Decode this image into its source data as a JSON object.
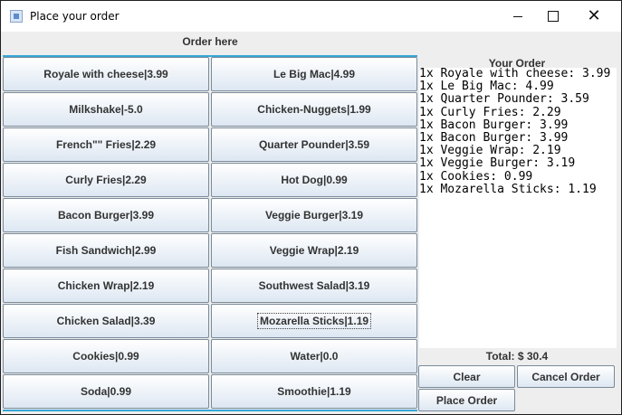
{
  "window": {
    "title": "Place your order",
    "controls": {
      "minimize": "minimize-icon",
      "maximize": "maximize-icon",
      "close": "close-icon"
    }
  },
  "menu": {
    "header": "Order here",
    "items": [
      "Royale with cheese|3.99",
      "Le Big Mac|4.99",
      "Milkshake|-5.0",
      "Chicken-Nuggets|1.99",
      "French\"\" Fries|2.29",
      "Quarter Pounder|3.59",
      "Curly Fries|2.29",
      "Hot Dog|0.99",
      "Bacon Burger|3.99",
      "Veggie Burger|3.19",
      "Fish Sandwich|2.99",
      "Veggie Wrap|2.19",
      "Chicken Wrap|2.19",
      "Southwest Salad|3.19",
      "Chicken Salad|3.39",
      "Mozarella Sticks|1.19",
      "Cookies|0.99",
      "Water|0.0",
      "Soda|0.99",
      "Smoothie|1.19"
    ]
  },
  "order": {
    "title": "Your Order",
    "lines": [
      "1x Royale with cheese: 3.99",
      "1x Le Big Mac: 4.99",
      "1x Quarter Pounder: 3.59",
      "1x Curly Fries: 2.29",
      "1x Bacon Burger: 3.99",
      "1x Bacon Burger: 3.99",
      "1x Veggie Wrap: 2.19",
      "1x Veggie Burger: 3.19",
      "1x Cookies: 0.99",
      "1x Mozarella Sticks: 1.19"
    ],
    "total": "Total: $ 30.4"
  },
  "actions": {
    "clear": "Clear",
    "cancel": "Cancel Order",
    "place": "Place Order"
  },
  "colors": {
    "accent": "#35a7d8",
    "button_border": "#7a8a99"
  }
}
